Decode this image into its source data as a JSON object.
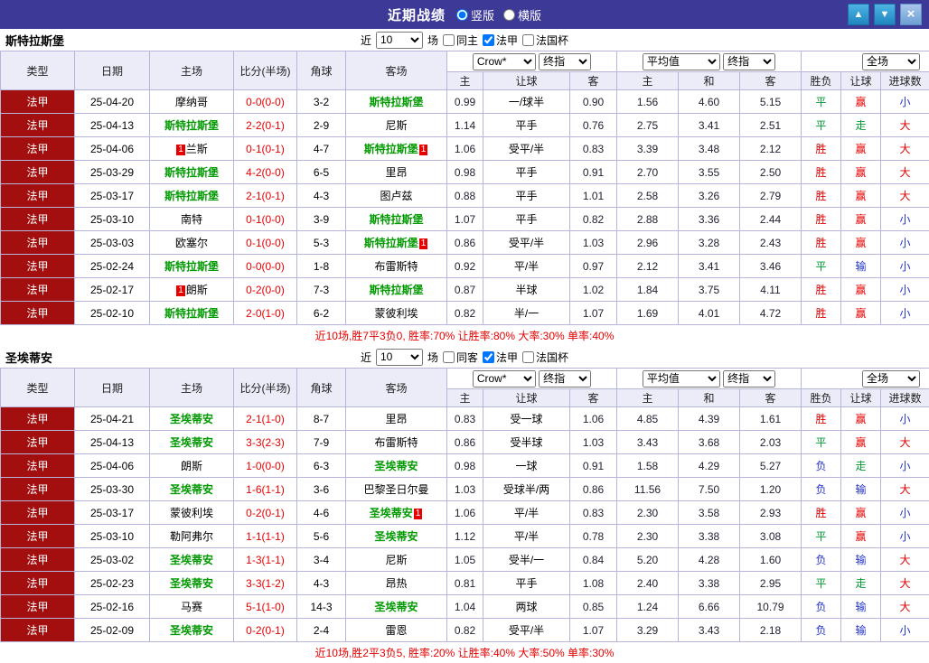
{
  "titlebar": {
    "title": "近期战绩",
    "radio_vertical": "竖版",
    "radio_horizontal": "横版",
    "buttons": {
      "up": "▲",
      "down": "▼",
      "close": "×"
    }
  },
  "labels": {
    "near": "近",
    "count": "10",
    "games": "场",
    "league": "法甲",
    "cup": "法国杯"
  },
  "table_header": {
    "match_cols": [
      "类型",
      "日期",
      "主场",
      "比分(半场)",
      "角球",
      "客场"
    ],
    "asia_sub": [
      "主",
      "让球",
      "客"
    ],
    "euro_sub": [
      "主",
      "和",
      "客"
    ],
    "result_sub": [
      "胜负",
      "让球",
      "进球数"
    ],
    "selects": {
      "bookmaker": "Crow*",
      "asia_type": "终指",
      "euro_avg": "平均值",
      "euro_type": "终指",
      "scope": "全场"
    }
  },
  "sections": [
    {
      "team": "斯特拉斯堡",
      "same_label": "同主",
      "summary": "近10场,胜7平3负0, 胜率:70% 让胜率:80% 大率:30% 单率:40%",
      "rows": [
        {
          "league": "法甲",
          "date": "25-04-20",
          "home": {
            "name": "摩纳哥",
            "hl": false,
            "badge": ""
          },
          "score": "0-0(0-0)",
          "corner": "3-2",
          "away": {
            "name": "斯特拉斯堡",
            "hl": true,
            "badge": ""
          },
          "asia": [
            "0.99",
            "一/球半",
            "0.90"
          ],
          "euro": [
            "1.56",
            "4.60",
            "5.15"
          ],
          "res": [
            "平",
            "赢",
            "小"
          ]
        },
        {
          "league": "法甲",
          "date": "25-04-13",
          "home": {
            "name": "斯特拉斯堡",
            "hl": true,
            "badge": ""
          },
          "score": "2-2(0-1)",
          "corner": "2-9",
          "away": {
            "name": "尼斯",
            "hl": false,
            "badge": ""
          },
          "asia": [
            "1.14",
            "平手",
            "0.76"
          ],
          "euro": [
            "2.75",
            "3.41",
            "2.51"
          ],
          "res": [
            "平",
            "走",
            "大"
          ]
        },
        {
          "league": "法甲",
          "date": "25-04-06",
          "home": {
            "name": "兰斯",
            "hl": false,
            "badge": "1"
          },
          "score": "0-1(0-1)",
          "corner": "4-7",
          "away": {
            "name": "斯特拉斯堡",
            "hl": true,
            "badge": "1"
          },
          "asia": [
            "1.06",
            "受平/半",
            "0.83"
          ],
          "euro": [
            "3.39",
            "3.48",
            "2.12"
          ],
          "res": [
            "胜",
            "赢",
            "大"
          ]
        },
        {
          "league": "法甲",
          "date": "25-03-29",
          "home": {
            "name": "斯特拉斯堡",
            "hl": true,
            "badge": ""
          },
          "score": "4-2(0-0)",
          "corner": "6-5",
          "away": {
            "name": "里昂",
            "hl": false,
            "badge": ""
          },
          "asia": [
            "0.98",
            "平手",
            "0.91"
          ],
          "euro": [
            "2.70",
            "3.55",
            "2.50"
          ],
          "res": [
            "胜",
            "赢",
            "大"
          ]
        },
        {
          "league": "法甲",
          "date": "25-03-17",
          "home": {
            "name": "斯特拉斯堡",
            "hl": true,
            "badge": ""
          },
          "score": "2-1(0-1)",
          "corner": "4-3",
          "away": {
            "name": "图卢兹",
            "hl": false,
            "badge": ""
          },
          "asia": [
            "0.88",
            "平手",
            "1.01"
          ],
          "euro": [
            "2.58",
            "3.26",
            "2.79"
          ],
          "res": [
            "胜",
            "赢",
            "大"
          ]
        },
        {
          "league": "法甲",
          "date": "25-03-10",
          "home": {
            "name": "南特",
            "hl": false,
            "badge": ""
          },
          "score": "0-1(0-0)",
          "corner": "3-9",
          "away": {
            "name": "斯特拉斯堡",
            "hl": true,
            "badge": ""
          },
          "asia": [
            "1.07",
            "平手",
            "0.82"
          ],
          "euro": [
            "2.88",
            "3.36",
            "2.44"
          ],
          "res": [
            "胜",
            "赢",
            "小"
          ]
        },
        {
          "league": "法甲",
          "date": "25-03-03",
          "home": {
            "name": "欧塞尔",
            "hl": false,
            "badge": ""
          },
          "score": "0-1(0-0)",
          "corner": "5-3",
          "away": {
            "name": "斯特拉斯堡",
            "hl": true,
            "badge": "1"
          },
          "asia": [
            "0.86",
            "受平/半",
            "1.03"
          ],
          "euro": [
            "2.96",
            "3.28",
            "2.43"
          ],
          "res": [
            "胜",
            "赢",
            "小"
          ]
        },
        {
          "league": "法甲",
          "date": "25-02-24",
          "home": {
            "name": "斯特拉斯堡",
            "hl": true,
            "badge": ""
          },
          "score": "0-0(0-0)",
          "corner": "1-8",
          "away": {
            "name": "布雷斯特",
            "hl": false,
            "badge": ""
          },
          "asia": [
            "0.92",
            "平/半",
            "0.97"
          ],
          "euro": [
            "2.12",
            "3.41",
            "3.46"
          ],
          "res": [
            "平",
            "输",
            "小"
          ]
        },
        {
          "league": "法甲",
          "date": "25-02-17",
          "home": {
            "name": "朗斯",
            "hl": false,
            "badge": "1"
          },
          "score": "0-2(0-0)",
          "corner": "7-3",
          "away": {
            "name": "斯特拉斯堡",
            "hl": true,
            "badge": ""
          },
          "asia": [
            "0.87",
            "半球",
            "1.02"
          ],
          "euro": [
            "1.84",
            "3.75",
            "4.11"
          ],
          "res": [
            "胜",
            "赢",
            "小"
          ]
        },
        {
          "league": "法甲",
          "date": "25-02-10",
          "home": {
            "name": "斯特拉斯堡",
            "hl": true,
            "badge": ""
          },
          "score": "2-0(1-0)",
          "corner": "6-2",
          "away": {
            "name": "蒙彼利埃",
            "hl": false,
            "badge": ""
          },
          "asia": [
            "0.82",
            "半/一",
            "1.07"
          ],
          "euro": [
            "1.69",
            "4.01",
            "4.72"
          ],
          "res": [
            "胜",
            "赢",
            "小"
          ]
        }
      ]
    },
    {
      "team": "圣埃蒂安",
      "same_label": "同客",
      "summary": "近10场,胜2平3负5, 胜率:20% 让胜率:40% 大率:50% 单率:30%",
      "rows": [
        {
          "league": "法甲",
          "date": "25-04-21",
          "home": {
            "name": "圣埃蒂安",
            "hl": true,
            "badge": ""
          },
          "score": "2-1(1-0)",
          "corner": "8-7",
          "away": {
            "name": "里昂",
            "hl": false,
            "badge": ""
          },
          "asia": [
            "0.83",
            "受一球",
            "1.06"
          ],
          "euro": [
            "4.85",
            "4.39",
            "1.61"
          ],
          "res": [
            "胜",
            "赢",
            "小"
          ]
        },
        {
          "league": "法甲",
          "date": "25-04-13",
          "home": {
            "name": "圣埃蒂安",
            "hl": true,
            "badge": ""
          },
          "score": "3-3(2-3)",
          "corner": "7-9",
          "away": {
            "name": "布雷斯特",
            "hl": false,
            "badge": ""
          },
          "asia": [
            "0.86",
            "受半球",
            "1.03"
          ],
          "euro": [
            "3.43",
            "3.68",
            "2.03"
          ],
          "res": [
            "平",
            "赢",
            "大"
          ]
        },
        {
          "league": "法甲",
          "date": "25-04-06",
          "home": {
            "name": "朗斯",
            "hl": false,
            "badge": ""
          },
          "score": "1-0(0-0)",
          "corner": "6-3",
          "away": {
            "name": "圣埃蒂安",
            "hl": true,
            "badge": ""
          },
          "asia": [
            "0.98",
            "一球",
            "0.91"
          ],
          "euro": [
            "1.58",
            "4.29",
            "5.27"
          ],
          "res": [
            "负",
            "走",
            "小"
          ]
        },
        {
          "league": "法甲",
          "date": "25-03-30",
          "home": {
            "name": "圣埃蒂安",
            "hl": true,
            "badge": ""
          },
          "score": "1-6(1-1)",
          "corner": "3-6",
          "away": {
            "name": "巴黎圣日尔曼",
            "hl": false,
            "badge": ""
          },
          "asia": [
            "1.03",
            "受球半/两",
            "0.86"
          ],
          "euro": [
            "11.56",
            "7.50",
            "1.20"
          ],
          "res": [
            "负",
            "输",
            "大"
          ]
        },
        {
          "league": "法甲",
          "date": "25-03-17",
          "home": {
            "name": "蒙彼利埃",
            "hl": false,
            "badge": ""
          },
          "score": "0-2(0-1)",
          "corner": "4-6",
          "away": {
            "name": "圣埃蒂安",
            "hl": true,
            "badge": "1"
          },
          "asia": [
            "1.06",
            "平/半",
            "0.83"
          ],
          "euro": [
            "2.30",
            "3.58",
            "2.93"
          ],
          "res": [
            "胜",
            "赢",
            "小"
          ]
        },
        {
          "league": "法甲",
          "date": "25-03-10",
          "home": {
            "name": "勒阿弗尔",
            "hl": false,
            "badge": ""
          },
          "score": "1-1(1-1)",
          "corner": "5-6",
          "away": {
            "name": "圣埃蒂安",
            "hl": true,
            "badge": ""
          },
          "asia": [
            "1.12",
            "平/半",
            "0.78"
          ],
          "euro": [
            "2.30",
            "3.38",
            "3.08"
          ],
          "res": [
            "平",
            "赢",
            "小"
          ]
        },
        {
          "league": "法甲",
          "date": "25-03-02",
          "home": {
            "name": "圣埃蒂安",
            "hl": true,
            "badge": ""
          },
          "score": "1-3(1-1)",
          "corner": "3-4",
          "away": {
            "name": "尼斯",
            "hl": false,
            "badge": ""
          },
          "asia": [
            "1.05",
            "受半/一",
            "0.84"
          ],
          "euro": [
            "5.20",
            "4.28",
            "1.60"
          ],
          "res": [
            "负",
            "输",
            "大"
          ]
        },
        {
          "league": "法甲",
          "date": "25-02-23",
          "home": {
            "name": "圣埃蒂安",
            "hl": true,
            "badge": ""
          },
          "score": "3-3(1-2)",
          "corner": "4-3",
          "away": {
            "name": "昂热",
            "hl": false,
            "badge": ""
          },
          "asia": [
            "0.81",
            "平手",
            "1.08"
          ],
          "euro": [
            "2.40",
            "3.38",
            "2.95"
          ],
          "res": [
            "平",
            "走",
            "大"
          ]
        },
        {
          "league": "法甲",
          "date": "25-02-16",
          "home": {
            "name": "马赛",
            "hl": false,
            "badge": ""
          },
          "score": "5-1(1-0)",
          "corner": "14-3",
          "away": {
            "name": "圣埃蒂安",
            "hl": true,
            "badge": ""
          },
          "asia": [
            "1.04",
            "两球",
            "0.85"
          ],
          "euro": [
            "1.24",
            "6.66",
            "10.79"
          ],
          "res": [
            "负",
            "输",
            "大"
          ]
        },
        {
          "league": "法甲",
          "date": "25-02-09",
          "home": {
            "name": "圣埃蒂安",
            "hl": true,
            "badge": ""
          },
          "score": "0-2(0-1)",
          "corner": "2-4",
          "away": {
            "name": "雷恩",
            "hl": false,
            "badge": ""
          },
          "asia": [
            "0.82",
            "受平/半",
            "1.07"
          ],
          "euro": [
            "3.29",
            "3.43",
            "2.18"
          ],
          "res": [
            "负",
            "输",
            "小"
          ]
        }
      ]
    }
  ]
}
